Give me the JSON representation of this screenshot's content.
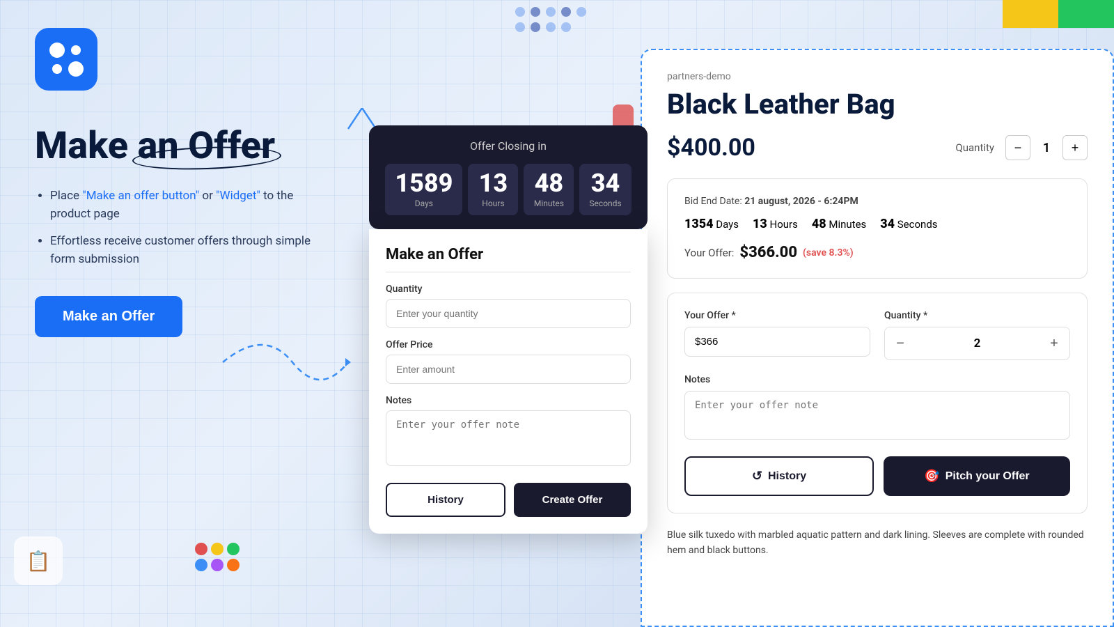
{
  "app": {
    "logo_dots": [
      1,
      1,
      1,
      1
    ],
    "top_bar": {
      "yellow": "#f5c518",
      "green": "#22c55e"
    }
  },
  "left": {
    "headline_part1": "Make ",
    "headline_highlight": "an Offer",
    "bullet1_pre": "Place ",
    "bullet1_link1": "\"Make an offer button\"",
    "bullet1_mid": " or ",
    "bullet1_link2": "\"Widget\"",
    "bullet1_post": " to the product page",
    "bullet2": "Effortless receive customer offers through simple form submission",
    "cta_label": "Make an Offer"
  },
  "modal": {
    "countdown_title": "Offer Closing in",
    "days_val": "1589",
    "days_label": "Days",
    "hours_val": "13",
    "hours_label": "Hours",
    "minutes_val": "48",
    "minutes_label": "Minutes",
    "seconds_val": "34",
    "seconds_label": "Seconds",
    "form_title": "Make an Offer",
    "qty_label": "Quantity",
    "qty_placeholder": "Enter your quantity",
    "price_label": "Offer Price",
    "price_placeholder": "Enter amount",
    "notes_label": "Notes",
    "notes_placeholder": "Enter your offer note",
    "btn_history": "History",
    "btn_create": "Create Offer"
  },
  "right": {
    "store_label": "partners-demo",
    "product_name": "Black Leather Bag",
    "price": "$400.00",
    "qty_label": "Quantity",
    "qty_value": "1",
    "bid_end_label": "Bid End Date:",
    "bid_end_value": "21 august, 2026 - 6:24PM",
    "countdown": {
      "days_val": "1354",
      "days_label": "Days",
      "hours_val": "13",
      "hours_label": "Hours",
      "minutes_val": "48",
      "minutes_label": "Minutes",
      "seconds_val": "34",
      "seconds_label": "Seconds"
    },
    "your_offer_label": "Your Offer:",
    "your_offer_price": "$366.00",
    "your_offer_save": "(save 8.3%)",
    "offer_label": "Your Offer *",
    "offer_value": "$366",
    "qty2_label": "Quantity *",
    "qty2_value": "2",
    "notes_label": "Notes",
    "notes_placeholder": "Enter your offer note",
    "btn_history": "History",
    "btn_pitch": "Pitch your Offer",
    "product_desc": "Blue silk tuxedo with marbled aquatic pattern and dark lining. Sleeves are complete with rounded hem and black buttons."
  }
}
